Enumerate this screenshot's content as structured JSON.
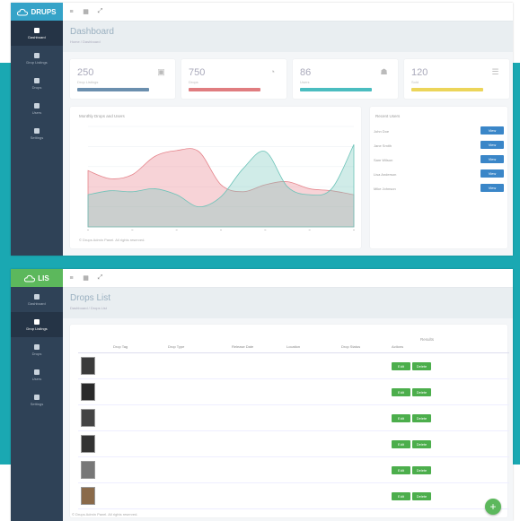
{
  "top": {
    "app_name": "DRUPS",
    "nav": [
      {
        "label": "Dashboard",
        "icon": "home-icon",
        "active": true
      },
      {
        "label": "Drop Listings",
        "icon": "grid-icon",
        "active": false
      },
      {
        "label": "Drops",
        "icon": "camera-icon",
        "active": false
      },
      {
        "label": "Users",
        "icon": "user-icon",
        "active": false
      },
      {
        "label": "Settings",
        "icon": "gear-icon",
        "active": false
      }
    ],
    "topbar_icons": [
      "≡",
      "▦",
      "⤢"
    ],
    "page_title": "Dashboard",
    "breadcrumb": "Home / Dashboard",
    "stats": [
      {
        "value": "250",
        "label": "Drop Listings",
        "icon": "image-icon",
        "color": "#6b8fae"
      },
      {
        "value": "750",
        "label": "Drops",
        "icon": "camera-icon",
        "color": "#e07d80"
      },
      {
        "value": "86",
        "label": "Users",
        "icon": "user-icon",
        "color": "#4bbdc0"
      },
      {
        "value": "120",
        "label": "Sold",
        "icon": "list-icon",
        "color": "#ecd55a"
      }
    ],
    "chart_panel_title": "Monthly Drops and Users",
    "footnote": "© Drups Admin Panel. All rights reserved.",
    "recent_title": "Recent Users",
    "recent": [
      {
        "name": "John Doe",
        "button": "View"
      },
      {
        "name": "Jane Smith",
        "button": "View"
      },
      {
        "name": "Sam Wilson",
        "button": "View"
      },
      {
        "name": "Lisa Anderson",
        "button": "View"
      },
      {
        "name": "Mike Johnson",
        "button": "View"
      }
    ]
  },
  "bottom": {
    "app_name": "LIS",
    "nav": [
      {
        "label": "Dashboard",
        "icon": "home-icon",
        "active": false
      },
      {
        "label": "Drop Listings",
        "icon": "grid-icon",
        "active": true
      },
      {
        "label": "Drops",
        "icon": "camera-icon",
        "active": false
      },
      {
        "label": "Users",
        "icon": "user-icon",
        "active": false
      },
      {
        "label": "Settings",
        "icon": "gear-icon",
        "active": false
      }
    ],
    "topbar_icons": [
      "≡",
      "▦",
      "⤢"
    ],
    "page_title": "Drops List",
    "breadcrumb": "Dashboard / Drops List",
    "table_caption": "Results",
    "columns": [
      "",
      "Drop Tag",
      "Drop Type",
      "Release Date",
      "Location",
      "Drop Status",
      "Actions"
    ],
    "rows": [
      {
        "tag": "",
        "type": "",
        "release": "",
        "location": "",
        "status": ""
      },
      {
        "tag": "",
        "type": "",
        "release": "",
        "location": "",
        "status": ""
      },
      {
        "tag": "",
        "type": "",
        "release": "",
        "location": "",
        "status": ""
      },
      {
        "tag": "",
        "type": "",
        "release": "",
        "location": "",
        "status": ""
      },
      {
        "tag": "",
        "type": "",
        "release": "",
        "location": "",
        "status": ""
      },
      {
        "tag": "",
        "type": "",
        "release": "",
        "location": "",
        "status": ""
      }
    ],
    "edit_label": "Edit",
    "delete_label": "Delete",
    "footnote": "© Drups Admin Panel. All rights reserved.",
    "fab": "+"
  },
  "colors": {
    "teal_background": "#1aa8b2",
    "sidebar": "#2f4257",
    "view_button": "#3a86c8",
    "action_button": "#4cae4c"
  },
  "chart_data": {
    "type": "area",
    "title": "Monthly Drops and Users",
    "x": [
      1,
      2,
      3,
      4,
      5,
      6,
      7,
      8,
      9,
      10,
      11,
      12,
      13
    ],
    "ylim": [
      0,
      100
    ],
    "grid": true,
    "series": [
      {
        "values": [
          56,
          48,
          52,
          70,
          76,
          75,
          42,
          35,
          42,
          45,
          38,
          36,
          32
        ]
      },
      {
        "values": [
          32,
          36,
          35,
          38,
          32,
          20,
          30,
          58,
          75,
          40,
          32,
          38,
          82
        ]
      }
    ]
  }
}
